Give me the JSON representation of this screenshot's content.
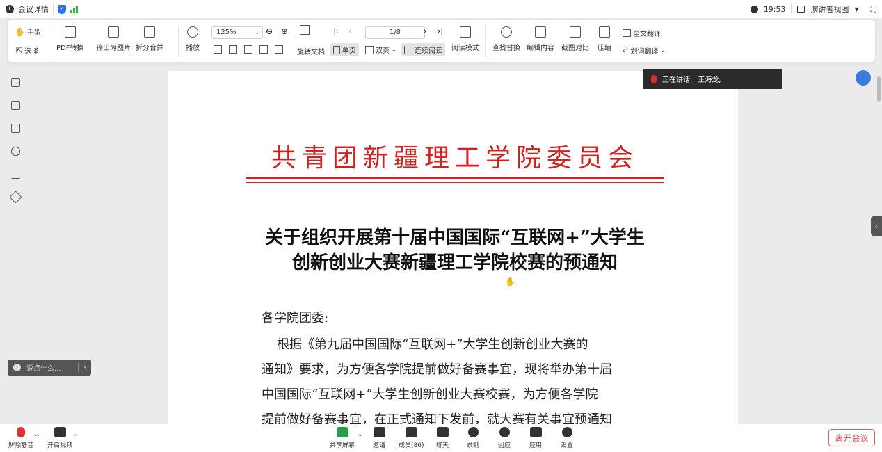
{
  "topbar": {
    "meeting_details": "会议详情",
    "time": "19:53",
    "presenter_view": "演讲者视图"
  },
  "toolbar": {
    "hand": "手型",
    "select": "选择",
    "pdf_convert": "PDF转换",
    "export_image": "输出为图片",
    "split_merge": "拆分合并",
    "play": "播放",
    "zoom": "125%",
    "rotate": "旋转文档",
    "single": "单页",
    "double": "双页",
    "continuous": "连续阅读",
    "reading_mode": "阅读模式",
    "page": "1/8",
    "find_replace": "查找替换",
    "edit_content": "编辑内容",
    "screenshot_compare": "截图对比",
    "compress": "压缩",
    "full_translate": "全文翻译",
    "word_translate": "划词翻译"
  },
  "document": {
    "org_header": "共青团新疆理工学院委员会",
    "title_line1": "关于组织开展第十届中国国际“互联网+”大学生",
    "title_line2": "创新创业大赛新疆理工学院校赛的预通知",
    "salutation": "各学院团委:",
    "p1": "根据《第九届中国国际“互联网+”大学生创新创业大赛的",
    "p2": "通知》要求，为方便各学院提前做好备赛事宜，现将举办第十届",
    "p3": "中国国际“互联网+”大学生创新创业大赛校赛，为方便各学院",
    "p4": "提前做好备赛事宜，在正式通知下发前，就大赛有关事宜预通知"
  },
  "speaking": {
    "label": "正在讲话:",
    "name": "王海龙;"
  },
  "chat_input": {
    "placeholder": "说点什么..."
  },
  "bottombar": {
    "unmute": "解除静音",
    "start_video": "开启视频",
    "share_screen": "共享屏幕",
    "invite": "邀请",
    "members": "成员(86)",
    "chat": "聊天",
    "record": "录制",
    "react": "回应",
    "apps": "应用",
    "settings": "设置",
    "leave": "离开会议"
  }
}
